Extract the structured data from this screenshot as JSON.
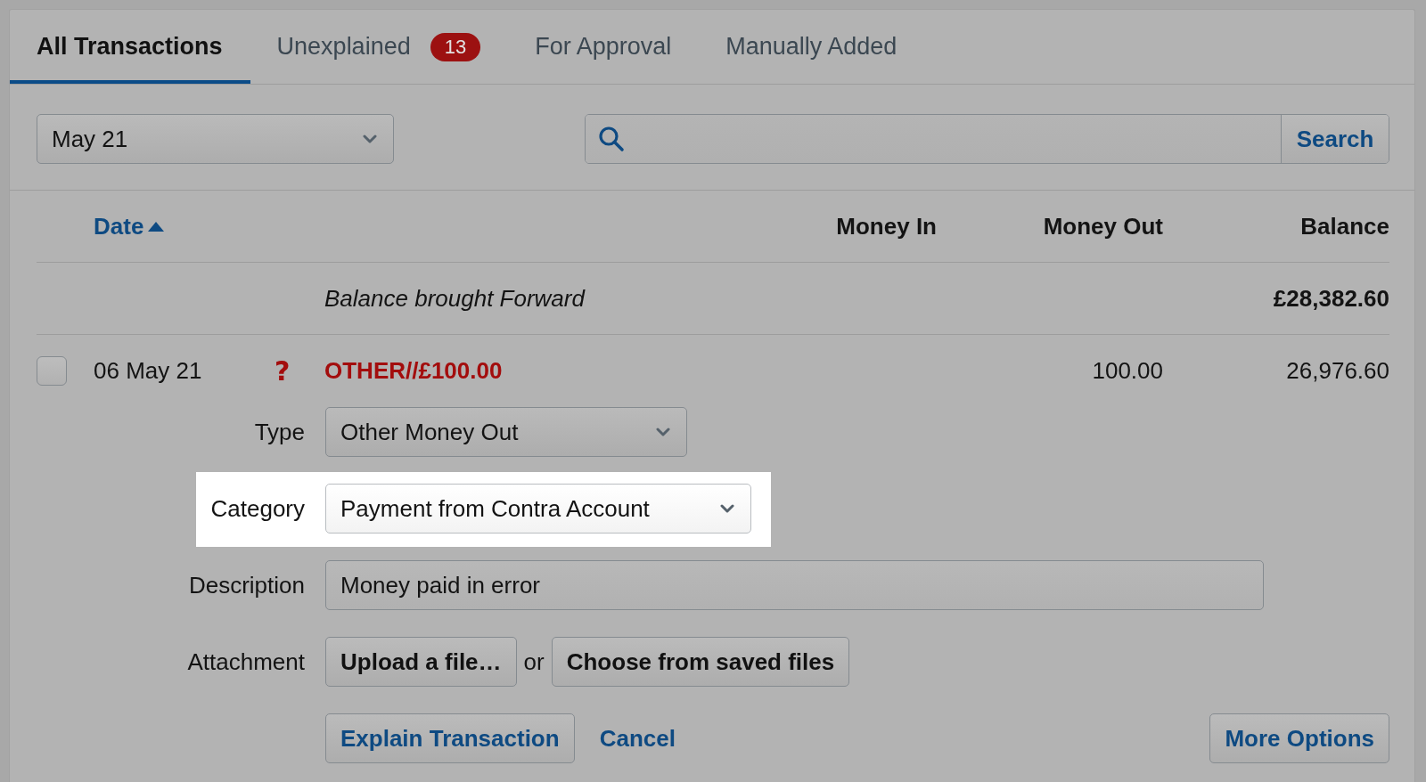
{
  "tabs": [
    {
      "label": "All Transactions",
      "selected": true
    },
    {
      "label": "Unexplained",
      "selected": false,
      "badge": "13"
    },
    {
      "label": "For Approval",
      "selected": false
    },
    {
      "label": "Manually Added",
      "selected": false
    }
  ],
  "filters": {
    "period": {
      "value": "May 21"
    },
    "search": {
      "button": "Search"
    }
  },
  "table": {
    "columns": [
      {
        "label": "Date",
        "sorted": true
      },
      {
        "label": "Money In",
        "sorted": false
      },
      {
        "label": "Money Out",
        "sorted": false
      },
      {
        "label": "Balance",
        "sorted": false
      }
    ],
    "opening_row": {
      "description": "Balance brought Forward",
      "balance": "£28,382.60"
    },
    "rows": [
      {
        "checked": false,
        "date": "06 May 21",
        "flag": "?",
        "description": "OTHER//£100.00",
        "money_out": "100.00",
        "balance": "26,976.60",
        "explain_form": {
          "fields": [
            {
              "kind": "select",
              "label": "Type",
              "value": "Other Money Out",
              "highlighted": false
            },
            {
              "kind": "select",
              "label": "Category",
              "value": "Payment from Contra Account",
              "highlighted": true
            },
            {
              "kind": "text",
              "label": "Description",
              "value": "Money paid in error",
              "highlighted": false
            },
            {
              "kind": "attachment",
              "label": "Attachment",
              "buttons": [
                "Upload a file…",
                "Choose from saved files"
              ],
              "separator": "or",
              "highlighted": false
            }
          ],
          "actions": [
            {
              "kind": "button",
              "label": "Explain Transaction"
            },
            {
              "kind": "link",
              "label": "Cancel"
            }
          ],
          "more_options": {
            "label": "More Options"
          }
        }
      }
    ]
  }
}
